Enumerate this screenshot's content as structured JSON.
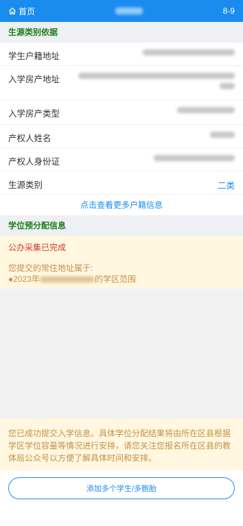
{
  "header": {
    "home_label": "首页",
    "right_text": "8-9",
    "accent": "#1a8cf0"
  },
  "source_section": {
    "title": "生源类别依据",
    "rows": [
      {
        "label": "学生户籍地址"
      },
      {
        "label": "入学房产地址"
      },
      {
        "label": "入学房产类型"
      },
      {
        "label": "产权人姓名"
      },
      {
        "label": "产权人身份证"
      },
      {
        "label": "生源类别",
        "value": "二类"
      }
    ],
    "more_link": "点击查看更多户籍信息"
  },
  "allocation_section": {
    "title": "学位预分配信息",
    "status": "公办采集已完成",
    "address_prefix": "您提交的常住地址属于:",
    "year_prefix": "●2023年",
    "area_suffix": "的学区范围"
  },
  "bottom": {
    "notice": "您已成功提交入学信息。具体学位分配结果将由所在区县根据学区学位容量等情况进行安排，请您关注您报名所在区县的教体局公众号以方便了解具体时间和安排。",
    "add_button": "添加多个学生/多胞胎"
  }
}
